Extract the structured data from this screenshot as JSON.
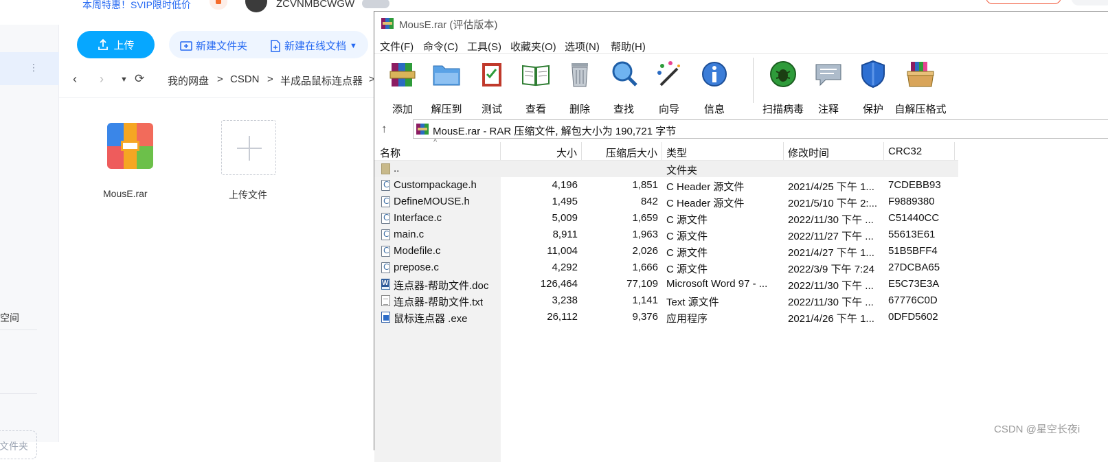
{
  "background_app": {
    "promo_text": "本周特惠！SVIP限时低价",
    "username": "ZCVNMBCWGW",
    "upload_label": "上传",
    "new_folder_label": "新建文件夹",
    "new_doc_label": "新建在线文档",
    "breadcrumb": [
      "我的网盘",
      "CSDN",
      "半成品鼠标连点器"
    ],
    "breadcrumb_sep": ">",
    "files": [
      {
        "name": "MousE.rar"
      },
      {
        "name": "上传文件"
      }
    ],
    "sidebar_text": "空间",
    "sidebar_button": "文件夹"
  },
  "rar_window": {
    "title": "MousE.rar (评估版本)",
    "menu": [
      "文件(F)",
      "命令(C)",
      "工具(S)",
      "收藏夹(O)",
      "选项(N)",
      "帮助(H)"
    ],
    "toolbar": [
      {
        "label": "添加",
        "icon": "archive-add-icon"
      },
      {
        "label": "解压到",
        "icon": "extract-folder-icon"
      },
      {
        "label": "测试",
        "icon": "test-clipboard-icon"
      },
      {
        "label": "查看",
        "icon": "view-book-icon"
      },
      {
        "label": "删除",
        "icon": "trash-icon"
      },
      {
        "label": "查找",
        "icon": "magnifier-icon"
      },
      {
        "label": "向导",
        "icon": "wizard-wand-icon"
      },
      {
        "label": "信息",
        "icon": "info-icon"
      },
      {
        "label": "扫描病毒",
        "icon": "virus-scan-icon"
      },
      {
        "label": "注释",
        "icon": "comment-icon"
      },
      {
        "label": "保护",
        "icon": "shield-icon"
      },
      {
        "label": "自解压格式",
        "icon": "sfx-box-icon"
      }
    ],
    "address": "MousE.rar - RAR 压缩文件, 解包大小为 190,721 字节",
    "columns": [
      "名称",
      "大小",
      "压缩后大小",
      "类型",
      "修改时间",
      "CRC32"
    ],
    "rows": [
      {
        "icon": "folder",
        "name": "..",
        "size": "",
        "packed": "",
        "type": "文件夹",
        "modified": "",
        "crc": ""
      },
      {
        "icon": "c",
        "name": "Custompackage.h",
        "size": "4,196",
        "packed": "1,851",
        "type": "C Header 源文件",
        "modified": "2021/4/25 下午 1...",
        "crc": "7CDEBB93"
      },
      {
        "icon": "c",
        "name": "DefineMOUSE.h",
        "size": "1,495",
        "packed": "842",
        "type": "C Header 源文件",
        "modified": "2021/5/10 下午 2:...",
        "crc": "F9889380"
      },
      {
        "icon": "c",
        "name": "Interface.c",
        "size": "5,009",
        "packed": "1,659",
        "type": "C 源文件",
        "modified": "2022/11/30 下午 ...",
        "crc": "C51440CC"
      },
      {
        "icon": "c",
        "name": "main.c",
        "size": "8,911",
        "packed": "1,963",
        "type": "C 源文件",
        "modified": "2022/11/27 下午 ...",
        "crc": "55613E61"
      },
      {
        "icon": "c",
        "name": "Modefile.c",
        "size": "11,004",
        "packed": "2,026",
        "type": "C 源文件",
        "modified": "2021/4/27 下午 1...",
        "crc": "51B5BFF4"
      },
      {
        "icon": "c",
        "name": "prepose.c",
        "size": "4,292",
        "packed": "1,666",
        "type": "C 源文件",
        "modified": "2022/3/9 下午 7:24",
        "crc": "27DCBA65"
      },
      {
        "icon": "doc",
        "name": "连点器-帮助文件.doc",
        "size": "126,464",
        "packed": "77,109",
        "type": "Microsoft Word 97 - ...",
        "modified": "2022/11/30 下午 ...",
        "crc": "E5C73E3A"
      },
      {
        "icon": "txt",
        "name": "连点器-帮助文件.txt",
        "size": "3,238",
        "packed": "1,141",
        "type": "Text 源文件",
        "modified": "2022/11/30 下午 ...",
        "crc": "67776C0D"
      },
      {
        "icon": "exe",
        "name": "鼠标连点器 .exe",
        "size": "26,112",
        "packed": "9,376",
        "type": "应用程序",
        "modified": "2021/4/26 下午 1...",
        "crc": "0DFD5602"
      }
    ]
  },
  "watermark": "CSDN @星空长夜i",
  "colors": {
    "accent": "#06a7ff",
    "link": "#2468f2"
  }
}
